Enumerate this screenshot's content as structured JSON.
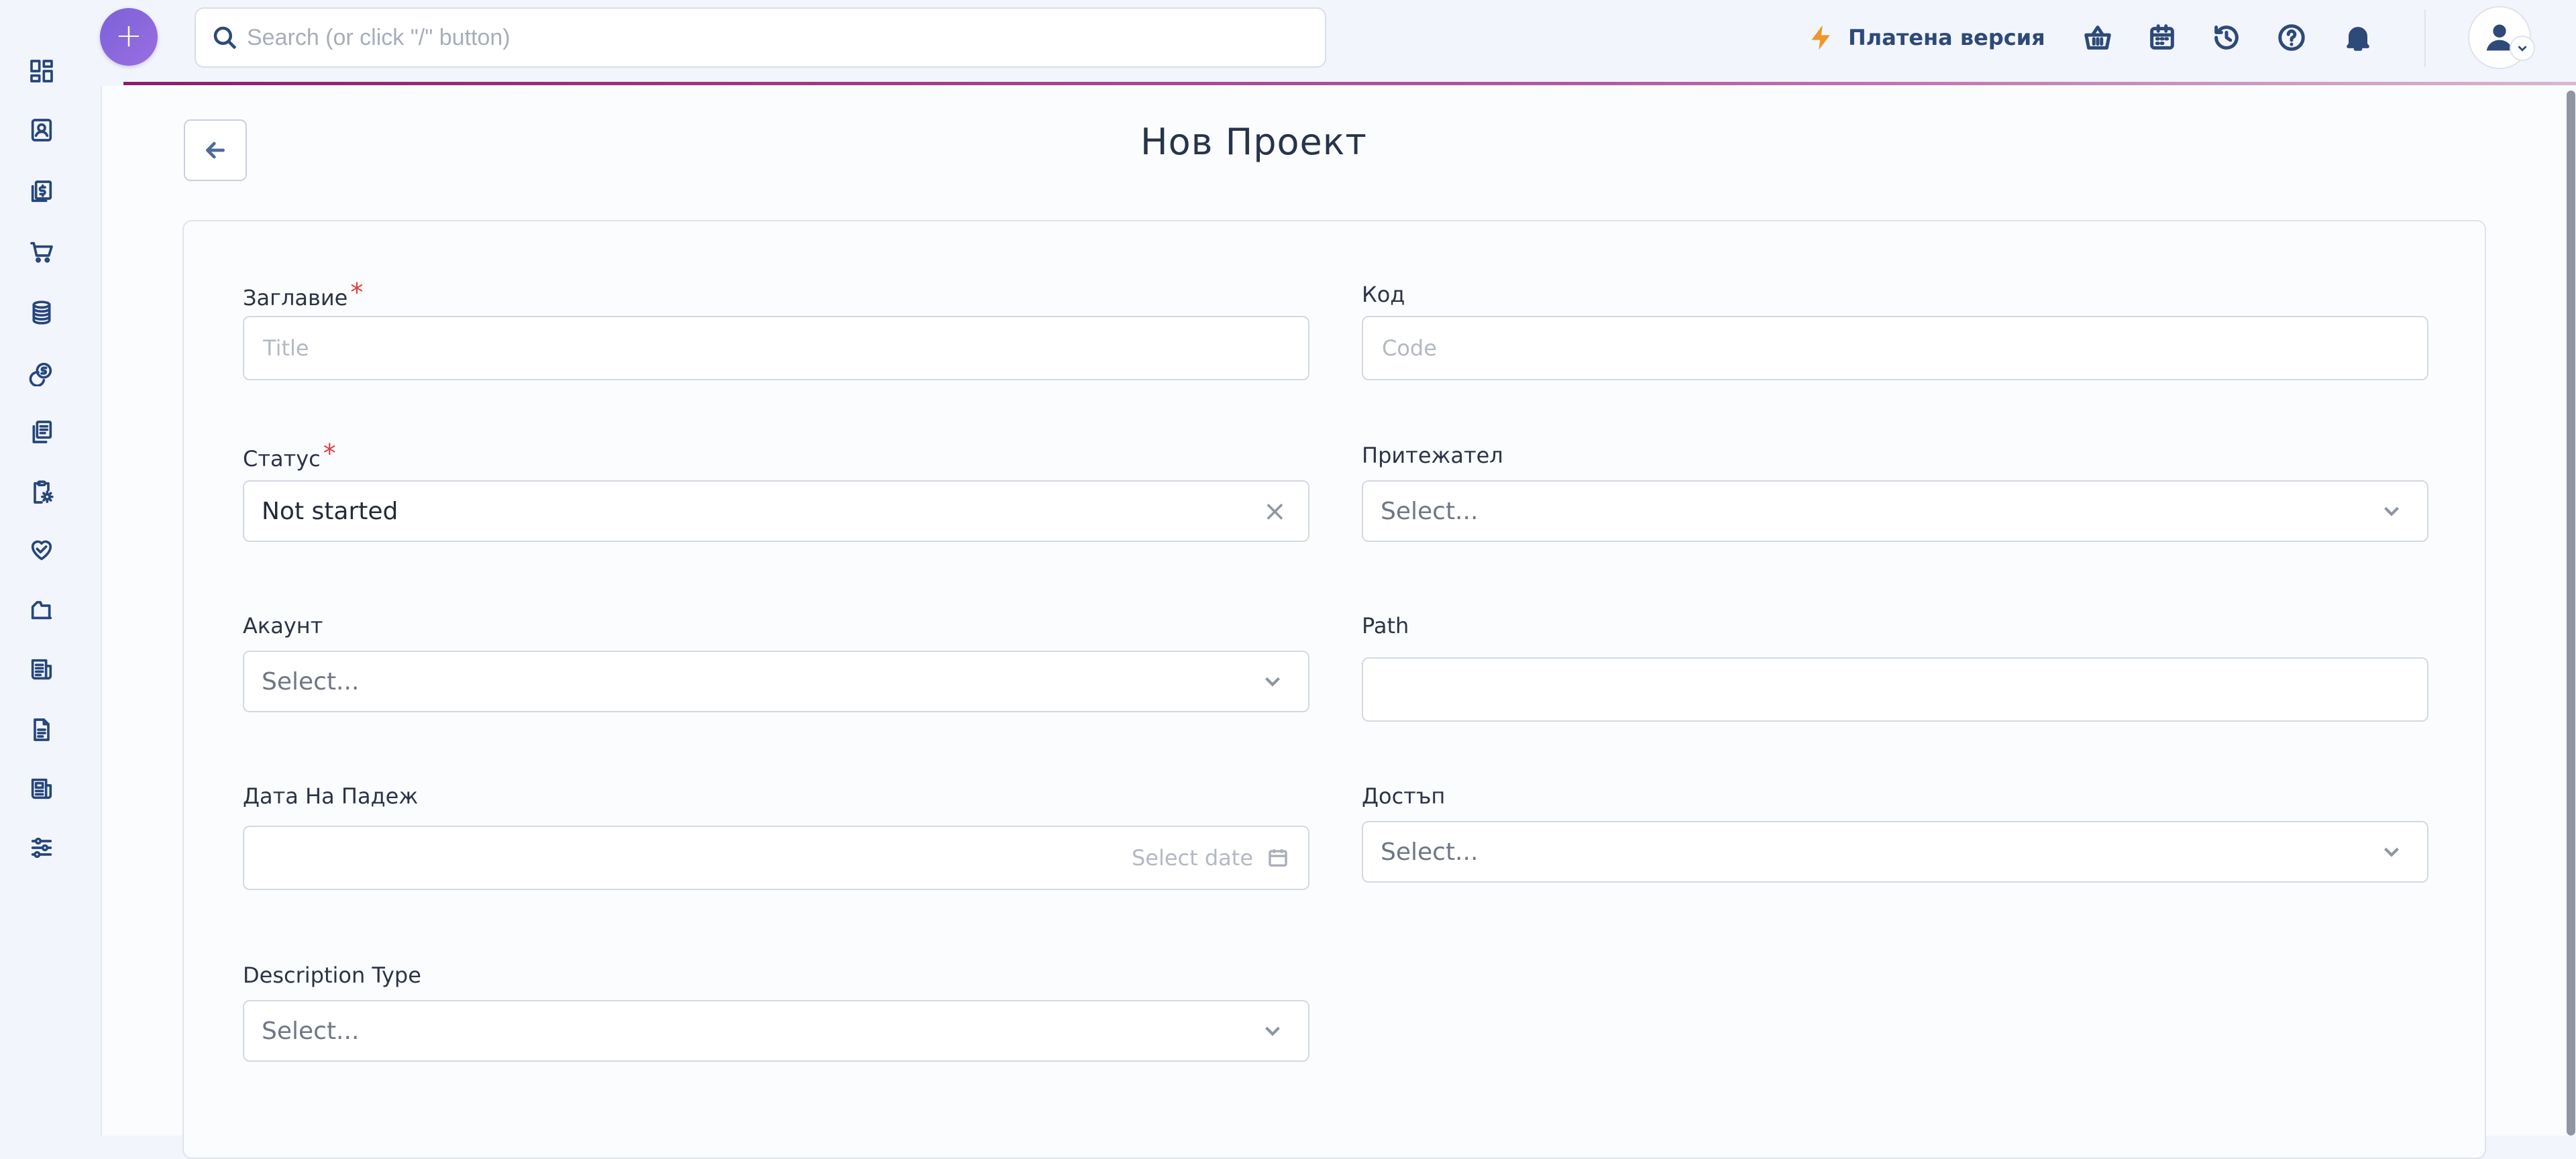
{
  "topbar": {
    "add_label": "+",
    "search_placeholder": "Search (or click \"/\" button)",
    "paid_label": "Платена версия",
    "icons": [
      "basket-icon",
      "calendar-icon",
      "history-icon",
      "help-icon",
      "bell-icon"
    ]
  },
  "sidebar": {
    "icons": [
      "dashboard-icon",
      "contacts-icon",
      "invoices-icon",
      "cart-icon",
      "database-icon",
      "coins-icon",
      "documents-icon",
      "clipboard-settings-icon",
      "heart-handshake-icon",
      "chart-icon",
      "news-icon",
      "file-text-icon",
      "reports-icon",
      "sliders-icon"
    ]
  },
  "page": {
    "title": "Нов Проект"
  },
  "form": {
    "title_label": "Заглавие",
    "title_placeholder": "Title",
    "code_label": "Код",
    "code_placeholder": "Code",
    "status_label": "Статус",
    "status_value": "Not started",
    "owner_label": "Притежател",
    "owner_placeholder": "Select...",
    "account_label": "Акаунт",
    "account_placeholder": "Select...",
    "path_label": "Path",
    "path_value": "",
    "due_date_label": "Дата На Падеж",
    "due_date_placeholder": "Select date",
    "access_label": "Достъп",
    "access_placeholder": "Select...",
    "description_type_label": "Description Type",
    "description_type_placeholder": "Select...",
    "required_mark": "*"
  },
  "colors": {
    "accent": "#8b1f6e",
    "fab": "#7b61d9",
    "paid_bolt": "#f0962e",
    "required": "#e0393e",
    "icon": "#27467a"
  }
}
